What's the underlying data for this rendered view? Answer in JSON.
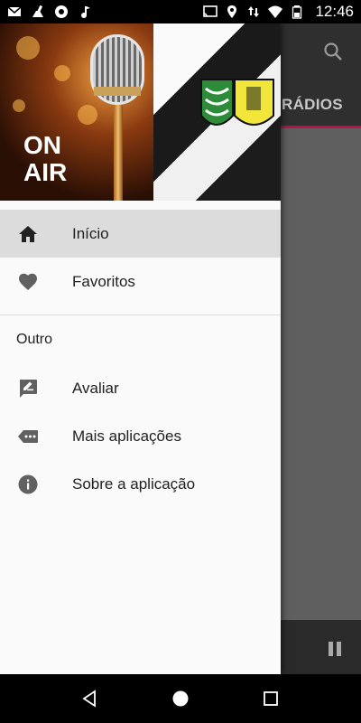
{
  "status_bar": {
    "time": "12:46",
    "left_icons": [
      "mail-icon",
      "cleaner-icon",
      "aperture-icon",
      "music-note-icon"
    ],
    "right_icons": [
      "cast-icon",
      "location-icon",
      "data-arrows-icon",
      "wifi-icon",
      "battery-icon"
    ]
  },
  "background_app": {
    "tab_label": "RÁDIOS",
    "accent_color": "#b5144b"
  },
  "drawer": {
    "header_text": "ON AIR",
    "items": [
      {
        "label": "Início",
        "icon": "home-icon",
        "active": true
      },
      {
        "label": "Favoritos",
        "icon": "heart-icon",
        "active": false
      }
    ],
    "section_title": "Outro",
    "other_items": [
      {
        "label": "Avaliar",
        "icon": "rate-review-icon"
      },
      {
        "label": "Mais aplicações",
        "icon": "more-apps-icon"
      },
      {
        "label": "Sobre a aplicação",
        "icon": "info-icon"
      }
    ]
  },
  "nav_bar": {
    "buttons": [
      "back-icon",
      "home-circle-icon",
      "recents-icon"
    ]
  }
}
